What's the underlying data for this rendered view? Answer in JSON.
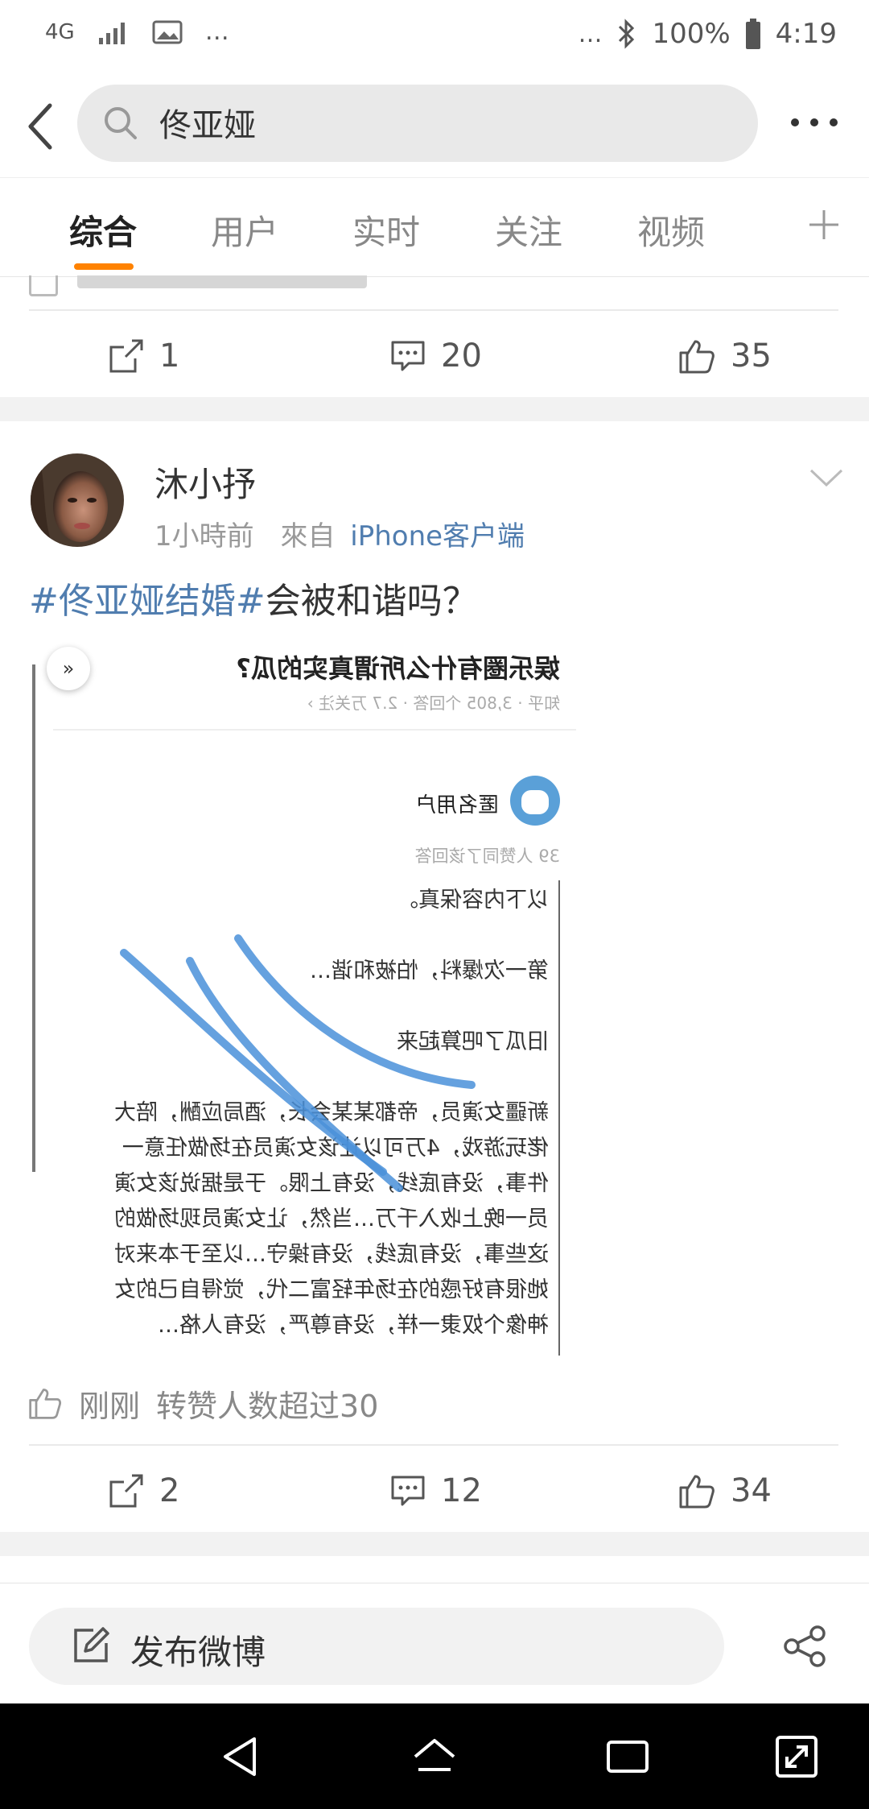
{
  "status_bar": {
    "network": "4G",
    "extra": "…",
    "extra_right": "…",
    "battery": "100%",
    "time": "4:19"
  },
  "search": {
    "query": "佟亚娅"
  },
  "tabs": [
    "综合",
    "用户",
    "实时",
    "关注",
    "视频"
  ],
  "active_tab": 0,
  "post1": {
    "repost_count": "1",
    "comment_count": "20",
    "like_count": "35"
  },
  "post2": {
    "username": "沐小抒",
    "time": "1小時前",
    "from_label": "來自",
    "client": "iPhone客户端",
    "hashtag": "#佟亚娅结婚#",
    "text": "会被和谐吗？",
    "liked_time": "刚刚",
    "liked_text": "转赞人数超过30",
    "repost_count": "2",
    "comment_count": "12",
    "like_count": "34",
    "image": {
      "question": "娱乐圈有什么所谓真实的瓜?",
      "question_meta": "知乎 · 3,805 个回答 · 2.7 万关注 ›",
      "answer_user": "匿名用户",
      "agree": "39 人赞同了该回答",
      "lines": [
        "以下内容保真。",
        "第一次爆料，怕被和谐…",
        "旧瓜了吧算起来",
        "新疆女演员，帝都某某会长，酒局应酬，陪大",
        "佬玩游戏，4万可以让该女演员在场做任意一",
        "件事，没有底线，没有上限。于是据说该女演",
        "员一晚上收入千万…当然，让女演员现场做的",
        "这些事，没有底线，没有操守…以至于本来对",
        "她很有好感的在场年轻富二代，觉得自己的女",
        "神像个奴隶一样，没有尊严，没有人格…"
      ]
    }
  },
  "composer": {
    "label": "发布微博"
  },
  "colors": {
    "accent": "#ff8200",
    "link": "#507daf"
  }
}
